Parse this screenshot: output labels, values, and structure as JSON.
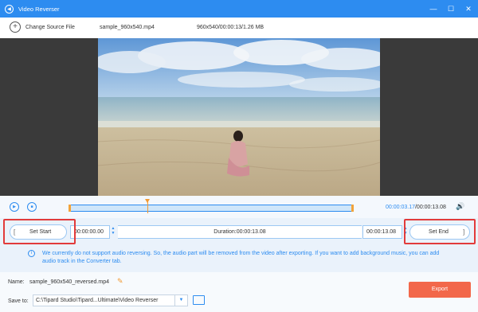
{
  "window": {
    "title": "Video Reverser",
    "minimize": "—",
    "maximize": "☐",
    "close": "✕"
  },
  "source": {
    "change_label": "Change Source File",
    "filename": "sample_960x540.mp4",
    "info": "960x540/00:00:13/1.26 MB"
  },
  "player": {
    "current_time": "00:00:03.17",
    "total_time": "/00:00:13.08",
    "playhead_fraction": 0.28
  },
  "trim": {
    "set_start_label": "Set Start",
    "start_time": "00:00:00.00",
    "duration": "Duration:00:00:13.08",
    "end_time": "00:00:13.08",
    "set_end_label": "Set End"
  },
  "notice": {
    "text": "We currently do not support audio reversing. So, the audio part will be removed from the video after exporting. If you want to add background music, you can add audio track in the Converter tab."
  },
  "output": {
    "name_label": "Name:",
    "name_value": "sample_960x540_reversed.mp4",
    "save_label": "Save to:",
    "save_path": "C:\\Tipard Studio\\Tipard...Ultimate\\Video Reverser",
    "export_label": "Export"
  },
  "colors": {
    "accent": "#2d8cf0",
    "export": "#f2684a",
    "highlight": "#e23b3b",
    "playhead": "#f29a33"
  }
}
